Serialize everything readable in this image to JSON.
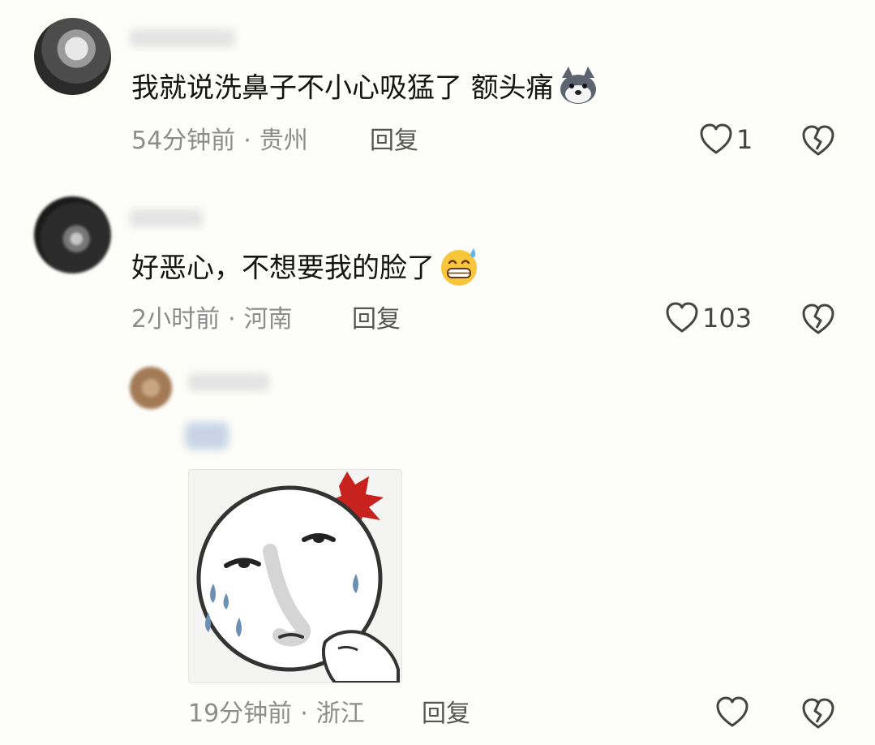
{
  "comments": [
    {
      "text": "我就说洗鼻子不小心吸猛了 额头痛",
      "emoji": "wolf-face-emoji",
      "time": "54分钟前",
      "location": "贵州",
      "reply_label": "回复",
      "likes": "1"
    },
    {
      "text": "好恶心，不想要我的脸了",
      "emoji": "grinning-sweat-emoji",
      "time": "2小时前",
      "location": "河南",
      "reply_label": "回复",
      "likes": "103"
    },
    {
      "text": "",
      "sticker": "crying-egg-head-sticker",
      "time": "19分钟前",
      "location": "浙江",
      "reply_label": "回复",
      "likes": ""
    }
  ],
  "meta_separator": "·",
  "icons": {
    "like": "heart-outline-icon",
    "dislike": "broken-heart-icon"
  },
  "colors": {
    "background": "#fdfdf9",
    "meta_text": "#8c8c8c",
    "icon_stroke": "#444444"
  }
}
